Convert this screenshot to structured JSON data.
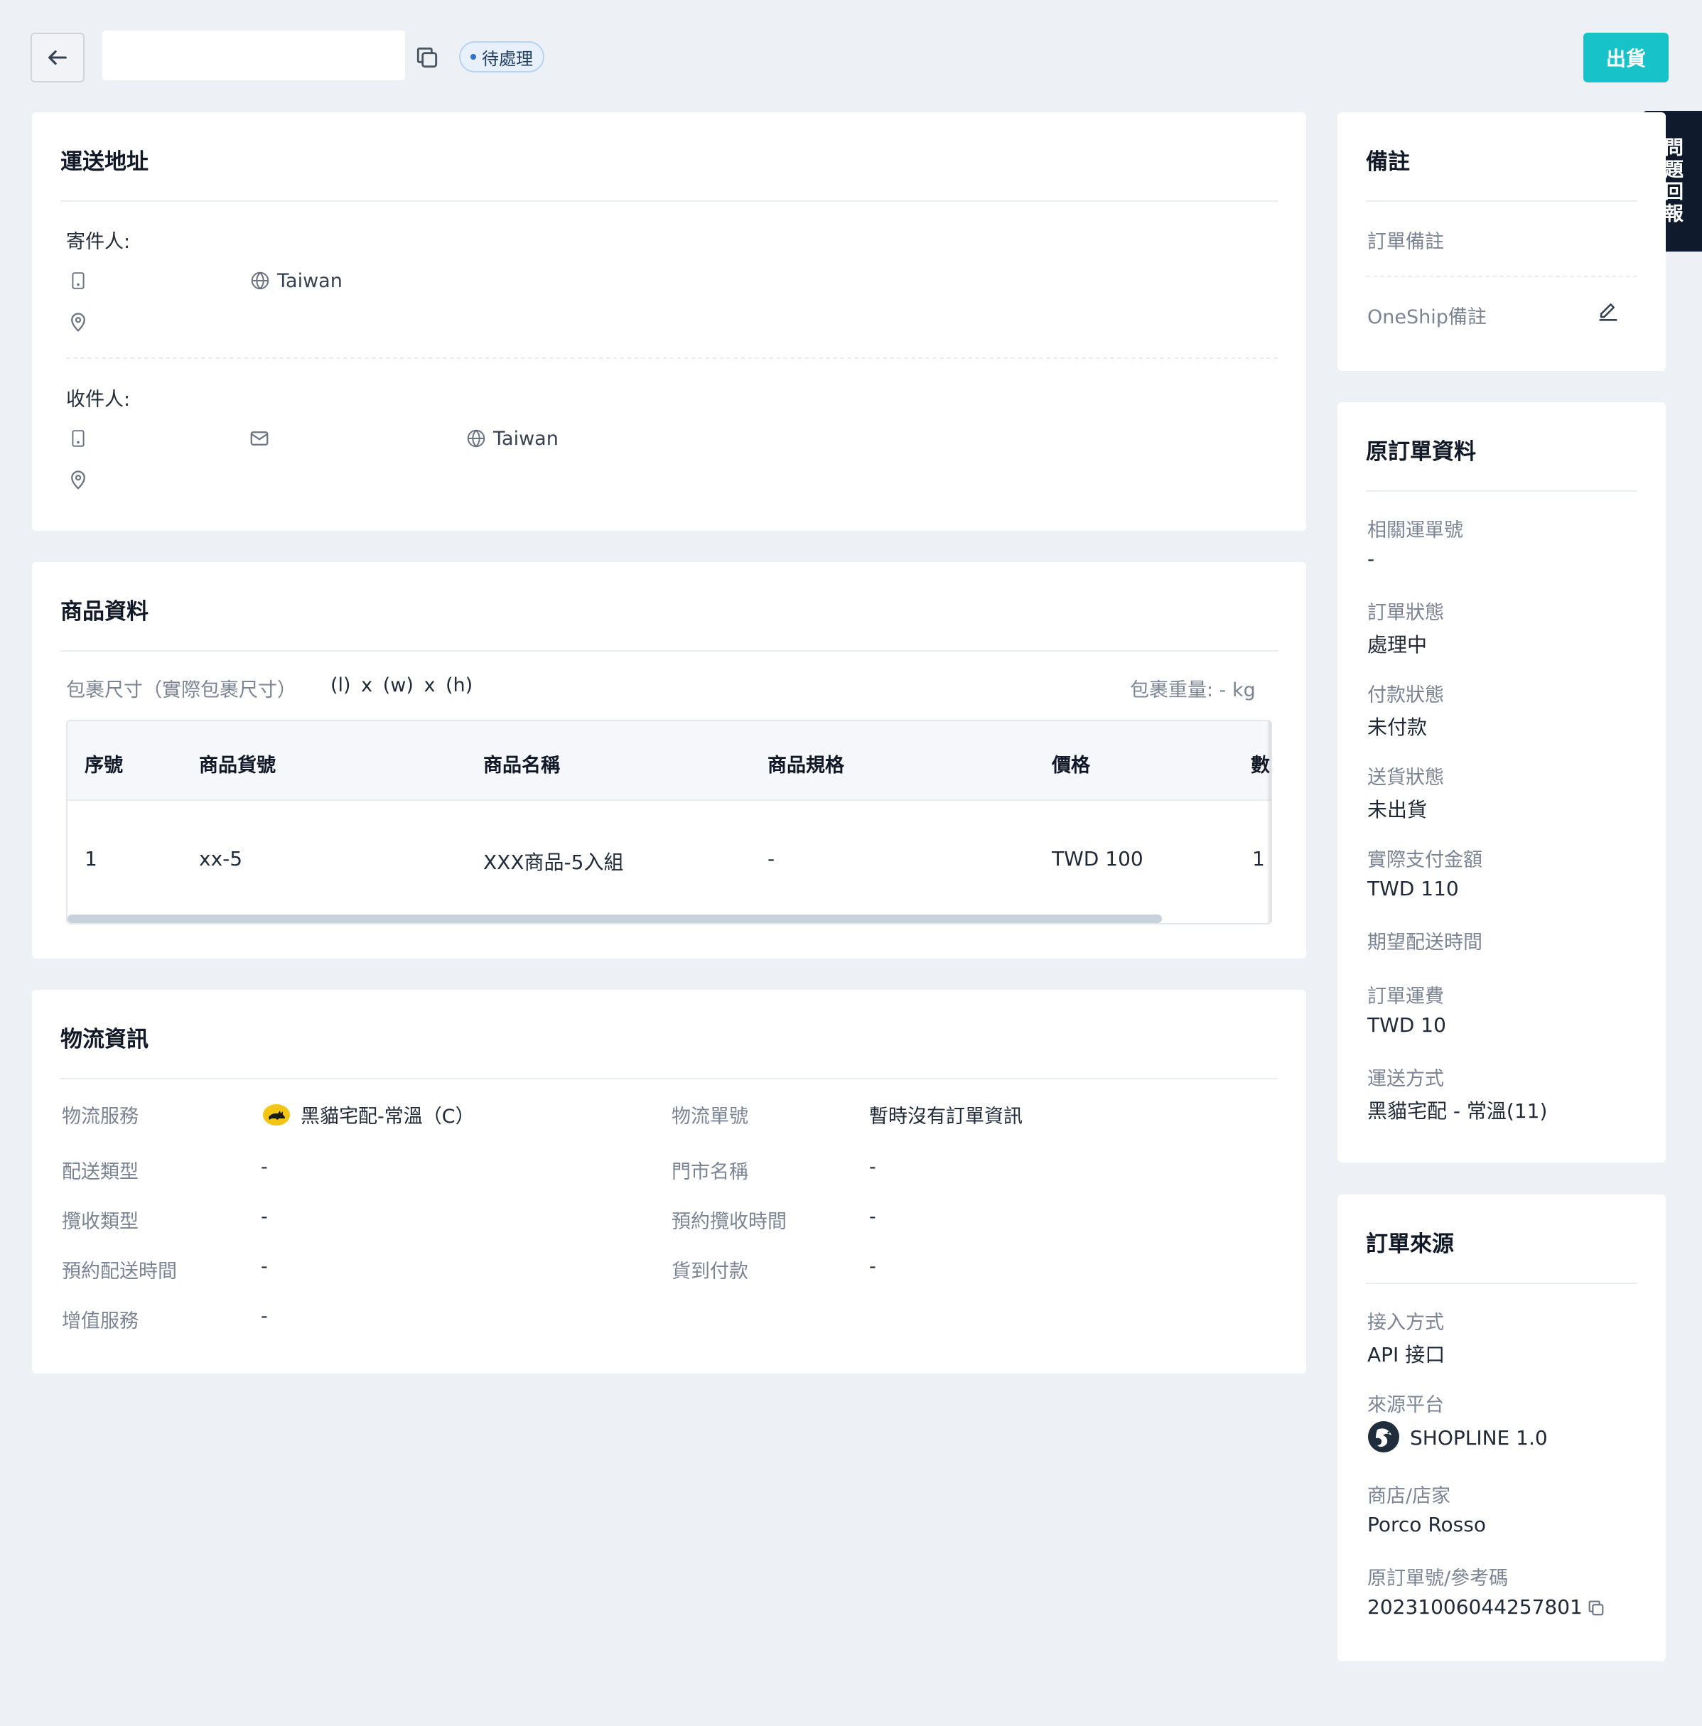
{
  "header": {
    "order_number_value": "",
    "status": "待處理",
    "ship_button": "出貨"
  },
  "feedback": {
    "label": "問題回報"
  },
  "shipping_address": {
    "title": "運送地址",
    "sender_label": "寄件人:",
    "sender_country": "Taiwan",
    "recipient_label": "收件人:",
    "recipient_country": "Taiwan"
  },
  "product_info": {
    "title": "商品資料",
    "package_size_label": "包裹尺寸（實際包裹尺寸）",
    "package_size_value": "(l) x (w) x (h)",
    "package_weight": "包裹重量: - kg",
    "columns": [
      "序號",
      "商品貨號",
      "商品名稱",
      "商品規格",
      "價格",
      "數"
    ],
    "rows": [
      [
        "1",
        "xx-5",
        "XXX商品-5入組",
        "-",
        "TWD 100",
        "1"
      ]
    ]
  },
  "logistics": {
    "title": "物流資訊",
    "left": [
      {
        "label": "物流服務",
        "value": "黑貓宅配-常溫（C）"
      },
      {
        "label": "配送類型",
        "value": "-"
      },
      {
        "label": "攬收類型",
        "value": "-"
      },
      {
        "label": "預約配送時間",
        "value": "-"
      },
      {
        "label": "增值服務",
        "value": "-"
      }
    ],
    "right": [
      {
        "label": "物流單號",
        "value": "暫時沒有訂單資訊"
      },
      {
        "label": "門市名稱",
        "value": "-"
      },
      {
        "label": "預約攬收時間",
        "value": "-"
      },
      {
        "label": "貨到付款",
        "value": "-"
      }
    ]
  },
  "notes": {
    "title": "備註",
    "order_note_label": "訂單備註",
    "oneship_note_label": "OneShip備註"
  },
  "original_order": {
    "title": "原訂單資料",
    "fields": [
      {
        "label": "相關運單號",
        "value": "-"
      },
      {
        "label": "訂單狀態",
        "value": "處理中"
      },
      {
        "label": "付款狀態",
        "value": "未付款"
      },
      {
        "label": "送貨狀態",
        "value": "未出貨"
      },
      {
        "label": "實際支付金額",
        "value": "TWD 110"
      },
      {
        "label": "期望配送時間",
        "value": ""
      },
      {
        "label": "訂單運費",
        "value": "TWD 10"
      },
      {
        "label": "運送方式",
        "value": "黑貓宅配 - 常溫(11)"
      }
    ]
  },
  "order_source": {
    "title": "訂單來源",
    "access_label": "接入方式",
    "access_value": "API 接口",
    "platform_label": "來源平台",
    "platform_value": "SHOPLINE 1.0",
    "store_label": "商店/店家",
    "store_value": "Porco Rosso",
    "ref_label": "原訂單號/參考碼",
    "ref_value": "20231006044257801"
  },
  "colors": {
    "accent": "#17c3c9",
    "status_badge_bg": "#e8f1fb",
    "feedback_bg": "#0f1b2d"
  }
}
